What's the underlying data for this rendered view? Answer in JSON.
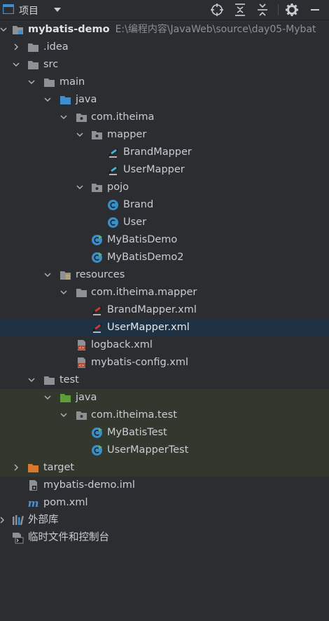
{
  "toolbar": {
    "title": "项目",
    "icons": [
      "select-opened-file-icon",
      "expand-all-icon",
      "collapse-all-icon",
      "settings-icon",
      "hide-icon"
    ]
  },
  "tree": {
    "project_name": "mybatis-demo",
    "project_path": "E:\\编程内容\\JavaWeb\\source\\day05-Mybat",
    "items": {
      "idea": ".idea",
      "src": "src",
      "main": "main",
      "java_main": "java",
      "pkg_itheima": "com.itheima",
      "mapper": "mapper",
      "brand_mapper": "BrandMapper",
      "user_mapper": "UserMapper",
      "pojo": "pojo",
      "brand": "Brand",
      "user": "User",
      "mybatis_demo": "MyBatisDemo",
      "mybatis_demo2": "MyBatisDemo2",
      "resources": "resources",
      "pkg_itheima_mapper": "com.itheima.mapper",
      "brand_mapper_xml": "BrandMapper.xml",
      "user_mapper_xml": "UserMapper.xml",
      "logback_xml": "logback.xml",
      "mybatis_config_xml": "mybatis-config.xml",
      "test": "test",
      "java_test": "java",
      "pkg_itheima_test": "com.itheima.test",
      "mybatis_test": "MyBatisTest",
      "user_mapper_test": "UserMapperTest",
      "target": "target",
      "iml": "mybatis-demo.iml",
      "pom": "pom.xml",
      "external_libs": "外部库",
      "scratches": "临时文件和控制台"
    },
    "selected": "UserMapper.xml",
    "colors": {
      "folder": "#8d9196",
      "source_folder": "#3d8fd1",
      "test_folder": "#5f9d3a",
      "excluded_folder": "#d9782e",
      "class_icon": "#3a8fc7",
      "selection": "#1f3244"
    }
  }
}
